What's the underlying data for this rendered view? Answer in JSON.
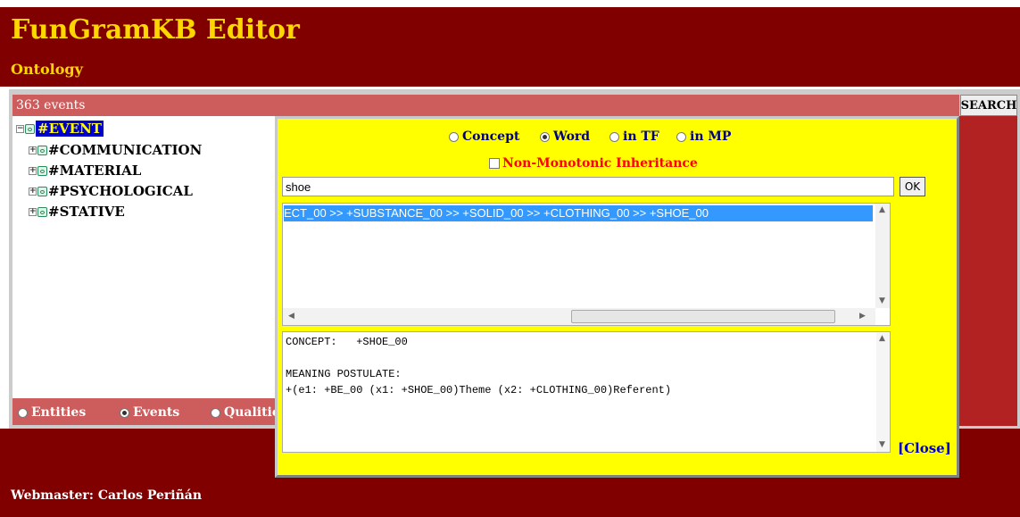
{
  "header": {
    "title": "FunGramKB Editor",
    "subtitle": "Ontology"
  },
  "events_bar": {
    "count_label": "363 events"
  },
  "search": {
    "label": "SEARCH"
  },
  "tree": {
    "root": "#EVENT",
    "children": [
      "#COMMUNICATION",
      "#MATERIAL",
      "#PSYCHOLOGICAL",
      "#STATIVE"
    ]
  },
  "bottom_tabs": {
    "items": [
      "Entities",
      "Events",
      "Qualitie"
    ],
    "selected": "Events"
  },
  "dialog": {
    "options": [
      "Concept",
      "Word",
      "in TF",
      "in MP"
    ],
    "selected_option": "Word",
    "checkbox_label": "Non-Monotonic Inheritance",
    "input_value": "shoe",
    "ok_label": "OK",
    "result": "ECT_00 >> +SUBSTANCE_00 >> +SOLID_00 >> +CLOTHING_00 >> +SHOE_00",
    "concept_line": "CONCEPT:   +SHOE_00",
    "mp_heading": "MEANING POSTULATE:",
    "mp_value": "+(e1: +BE_00 (x1: +SHOE_00)Theme (x2: +CLOTHING_00)Referent)",
    "close_label": "[Close]"
  },
  "footer": {
    "text": "Webmaster: Carlos Periñán"
  },
  "colors": {
    "maroon": "#800000",
    "gold": "#ffd700",
    "bar": "#cd5c5c",
    "dialog": "#ffff00",
    "selection": "#3399ff"
  }
}
